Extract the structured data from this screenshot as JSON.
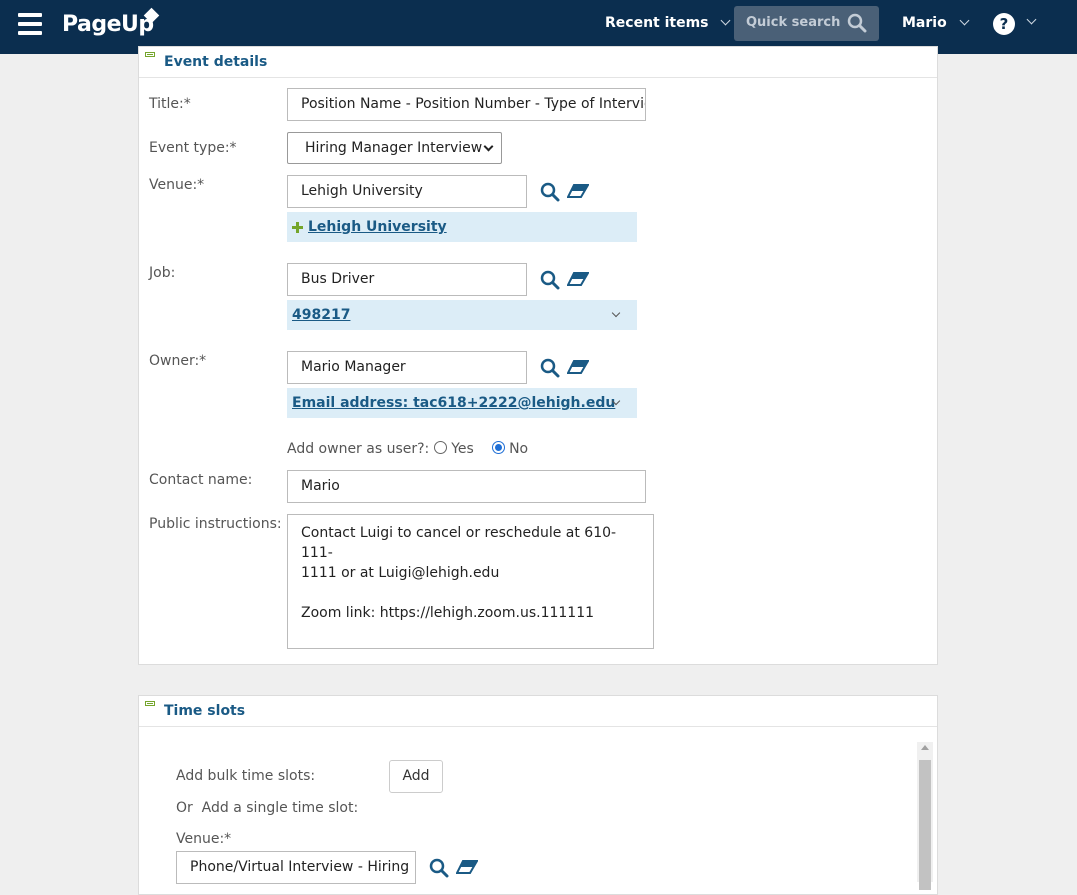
{
  "header": {
    "logo": "PageUp",
    "recent_items": "Recent items",
    "quick_search": "Quick search",
    "user": "Mario",
    "help": "?"
  },
  "event_details": {
    "heading": "Event details",
    "title_label": "Title:*",
    "title_value": "Position Name - Position Number - Type of Intervie",
    "event_type_label": "Event type:*",
    "event_type_value": "Hiring Manager Interview",
    "venue_label": "Venue:*",
    "venue_value": "Lehigh University",
    "venue_selected": "Lehigh University",
    "job_label": "Job:",
    "job_value": "Bus Driver",
    "job_selected": "498217",
    "owner_label": "Owner:*",
    "owner_value": "Mario Manager",
    "owner_selected": "Email address: tac618+2222@lehigh.edu",
    "add_owner_label": "Add owner as user?:",
    "yes_label": "Yes",
    "no_label": "No",
    "contact_label": "Contact name:",
    "contact_value": "Mario",
    "instructions_label": "Public instructions:",
    "instructions_line1": "Contact Luigi to cancel or reschedule at 610-111-",
    "instructions_line2": "1111 or at Luigi@lehigh.edu",
    "instructions_line3": "Zoom link: https://lehigh.zoom.us.111111"
  },
  "time_slots": {
    "heading": "Time slots",
    "bulk_label": "Add bulk time slots:",
    "add_button": "Add",
    "single_label": "Or  Add a single time slot:",
    "venue_label": "Venue:*",
    "venue_value": "Phone/Virtual Interview - Hiring M"
  },
  "colors": {
    "topbar": "#0b2e4f",
    "link": "#1a5a85",
    "selected_bg": "#dcedf7",
    "accent_green": "#74a52b"
  }
}
